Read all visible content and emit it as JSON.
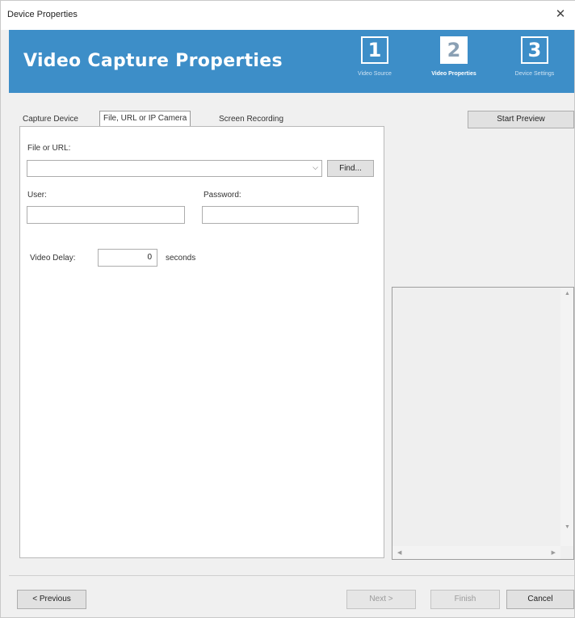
{
  "window": {
    "title": "Device Properties",
    "close_glyph": "✕"
  },
  "banner": {
    "title": "Video Capture Properties",
    "steps": [
      {
        "number": "1",
        "label": "Video Source"
      },
      {
        "number": "2",
        "label": "Video Properties",
        "active": true
      },
      {
        "number": "3",
        "label": "Device Settings"
      }
    ],
    "color": "#3d8ec8"
  },
  "tabs": [
    {
      "label": "Capture Device"
    },
    {
      "label": "File, URL or IP Camera",
      "active": true
    },
    {
      "label": "Screen Recording"
    }
  ],
  "form": {
    "file_label": "File or URL:",
    "file_value": "",
    "find_label": "Find...",
    "user_label": "User:",
    "user_value": "",
    "password_label": "Password:",
    "password_value": "",
    "delay_label": "Video Delay:",
    "delay_value": "0",
    "delay_unit": "seconds"
  },
  "preview": {
    "start_label": "Start Preview"
  },
  "footer": {
    "previous_label": "< Previous",
    "next_label": "Next >",
    "finish_label": "Finish",
    "cancel_label": "Cancel"
  }
}
